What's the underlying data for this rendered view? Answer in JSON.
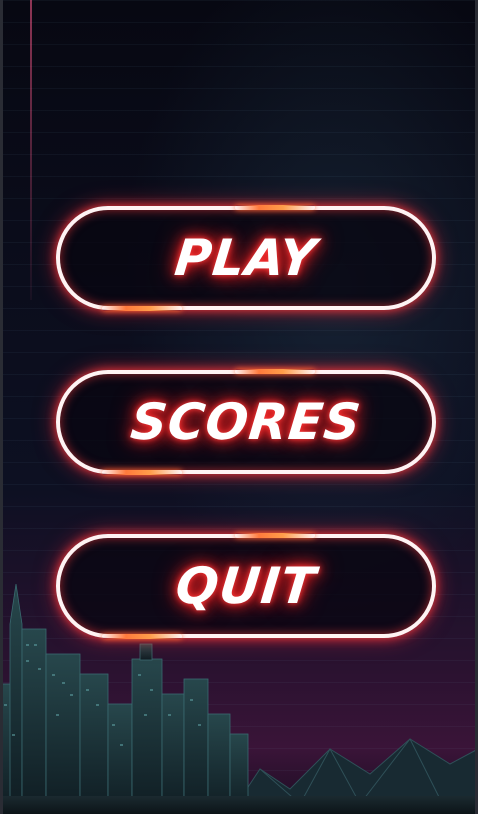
{
  "menu": {
    "buttons": [
      {
        "label": "PLAY"
      },
      {
        "label": "SCORES"
      },
      {
        "label": "QUIT"
      }
    ]
  },
  "colors": {
    "button_border": "#fff3f3",
    "glow": "#ff2020",
    "accent": "#ff7a3c",
    "city": "#1e3a40"
  },
  "icons": {
    "skyline": "city-skyline-icon",
    "mountains": "mountain-range-icon"
  }
}
